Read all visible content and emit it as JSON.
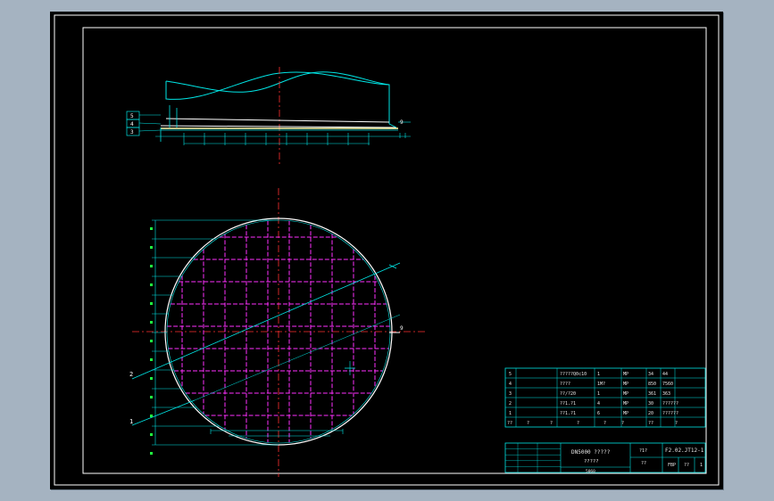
{
  "drawing": {
    "balloons": {
      "elevation": [
        "5",
        "4",
        "3"
      ],
      "plan": [
        "2",
        "1"
      ],
      "section_mark": "9"
    },
    "title_block": {
      "bom_rows": [
        [
          "5",
          "?????Q0c10",
          "1",
          "MP",
          "34",
          "44"
        ],
        [
          "4",
          "????",
          "1M?",
          "MP",
          "850",
          "7560"
        ],
        [
          "3",
          "??/?20",
          "1",
          "MP",
          "361",
          "363"
        ],
        [
          "2",
          "??1.?1",
          "4",
          "MP",
          "30",
          "??????"
        ],
        [
          "1",
          "??1.?1",
          "6",
          "MP",
          "20",
          "??????"
        ]
      ],
      "bom_header": [
        "??",
        "?",
        "?",
        "?",
        "?",
        "?",
        "??",
        "?"
      ],
      "title": "DN5000 ?????",
      "subtitle": "?????",
      "drawing_no": "F2.02.JT12-1",
      "scale_label": "?1?",
      "scale": "??",
      "sheet_fmt": "FBP",
      "sheet_a": "??",
      "sheet_b": "1",
      "footer_id": "5060"
    }
  }
}
